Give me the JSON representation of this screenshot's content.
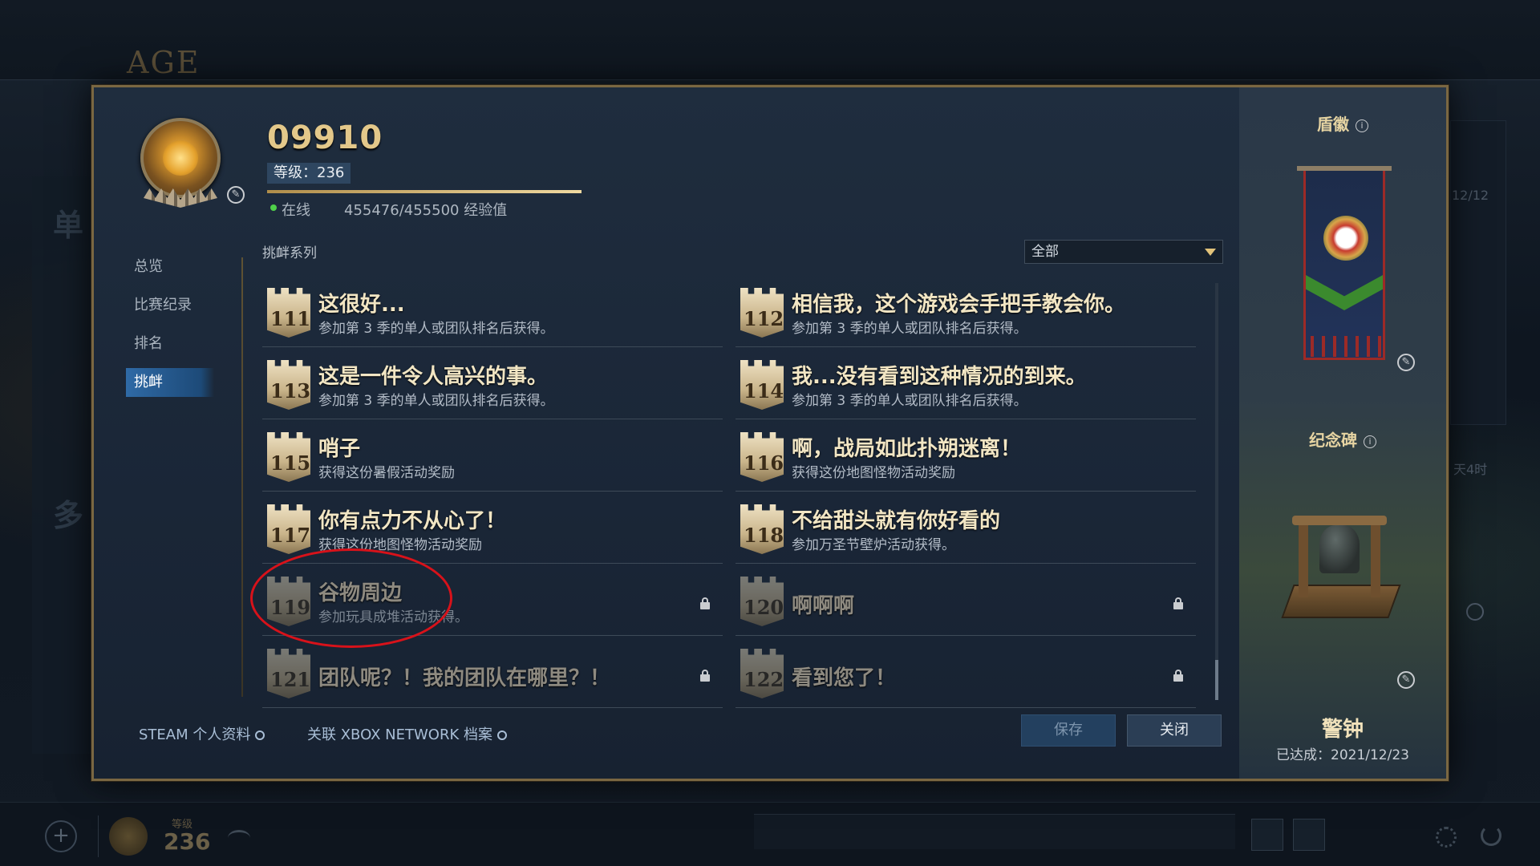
{
  "background": {
    "logo": "AGE",
    "right_date": "12/12",
    "right_time": "天4时",
    "left_chars": [
      "单",
      "多"
    ],
    "bottom": {
      "level_label": "等级",
      "level_value": "236"
    }
  },
  "profile": {
    "name": "09910",
    "level_label": "等级：236",
    "xp_fraction": 1.0,
    "status": "在线",
    "xp_text": "455476/455500 经验值"
  },
  "nav": {
    "items": [
      {
        "label": "总览"
      },
      {
        "label": "比赛纪录"
      },
      {
        "label": "排名"
      },
      {
        "label": "挑衅"
      }
    ],
    "active_index": 3
  },
  "taunts": {
    "section_title": "挑衅系列",
    "filter_value": "全部",
    "items": [
      {
        "num": "111",
        "title": "这很好...",
        "desc": "参加第 3 季的单人或团队排名后获得。",
        "locked": false
      },
      {
        "num": "112",
        "title": "相信我，这个游戏会手把手教会你。",
        "desc": "参加第 3 季的单人或团队排名后获得。",
        "locked": false
      },
      {
        "num": "113",
        "title": "这是一件令人高兴的事。",
        "desc": "参加第 3 季的单人或团队排名后获得。",
        "locked": false
      },
      {
        "num": "114",
        "title": "我...没有看到这种情况的到来。",
        "desc": "参加第 3 季的单人或团队排名后获得。",
        "locked": false
      },
      {
        "num": "115",
        "title": "哨子",
        "desc": "获得这份暑假活动奖励",
        "locked": false
      },
      {
        "num": "116",
        "title": "啊，战局如此扑朔迷离！",
        "desc": "获得这份地图怪物活动奖励",
        "locked": false
      },
      {
        "num": "117",
        "title": "你有点力不从心了！",
        "desc": "获得这份地图怪物活动奖励",
        "locked": false
      },
      {
        "num": "118",
        "title": "不给甜头就有你好看的",
        "desc": "参加万圣节壁炉活动获得。",
        "locked": false
      },
      {
        "num": "119",
        "title": "谷物周边",
        "desc": "参加玩具成堆活动获得。",
        "locked": true
      },
      {
        "num": "120",
        "title": "啊啊啊",
        "desc": "",
        "locked": true
      },
      {
        "num": "121",
        "title": "团队呢？！我的团队在哪里？！",
        "desc": "",
        "locked": true
      },
      {
        "num": "122",
        "title": "看到您了！",
        "desc": "",
        "locked": true
      }
    ]
  },
  "footer": {
    "steam_link": "STEAM 个人资料",
    "xbox_link": "关联 XBOX NETWORK 档案",
    "save_label": "保存",
    "close_label": "关闭"
  },
  "right": {
    "shield_title": "盾徽",
    "monument_title": "纪念碑",
    "monument_name": "警钟",
    "monument_date": "已达成：2021/12/23"
  },
  "colors": {
    "accent_gold": "#e3c88a",
    "nav_active": "#2f6aa6",
    "highlight_ring": "#d8121a",
    "online": "#4fd14a"
  }
}
